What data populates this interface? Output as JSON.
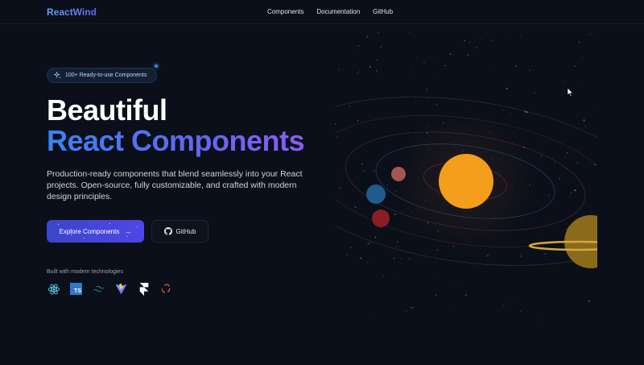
{
  "nav": {
    "logo": "ReactWind",
    "links": [
      "Components",
      "Documentation",
      "GitHub"
    ]
  },
  "hero": {
    "badge": "100+ Ready-to-use Components",
    "title_line1": "Beautiful",
    "title_line2": "React Components",
    "subtitle": "Production-ready components that blend seamlessly into your React projects. Open-source, fully customizable, and crafted with modern design principles.",
    "primary_button": "Explore Components",
    "secondary_button": "GitHub"
  },
  "tech": {
    "label": "Built with modern technologies",
    "icons": [
      "react-icon",
      "typescript-icon",
      "tailwind-icon",
      "vite-icon",
      "framer-icon",
      "redux-icon"
    ],
    "ts_text": "TS"
  },
  "colors": {
    "background": "#0b0f19",
    "accent": "#4f46e5",
    "sun": "#f59e1b",
    "planet_blue": "#1f5b8c",
    "planet_red": "#8b1e24",
    "planet_rose": "#a4564f",
    "saturn": "#8a6a1b"
  }
}
